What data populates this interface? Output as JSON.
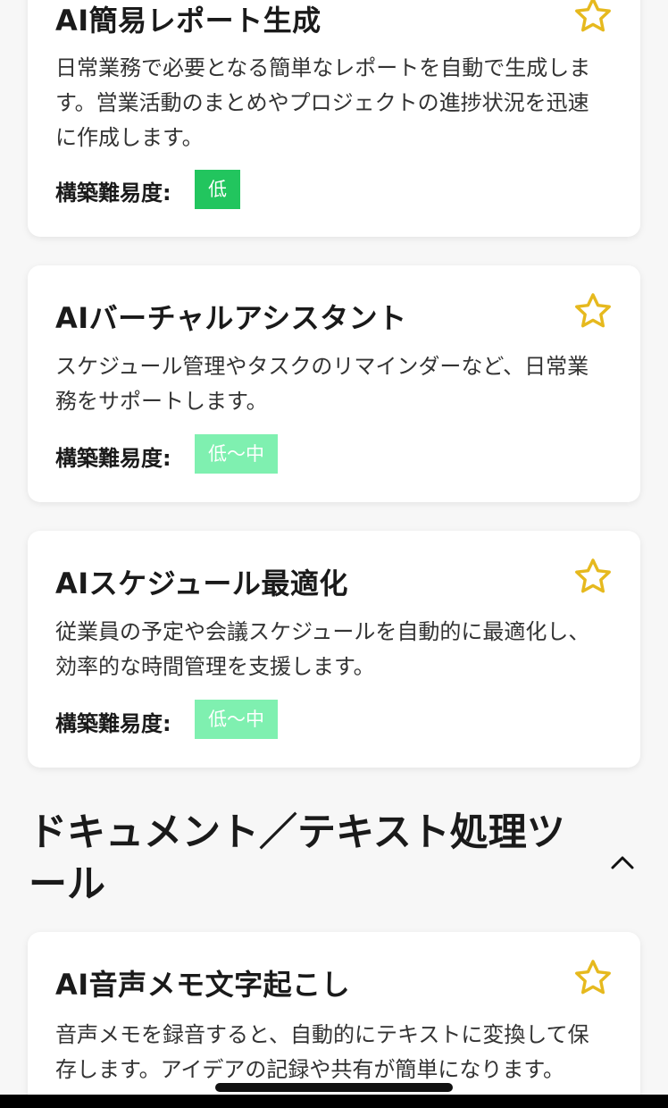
{
  "cards": [
    {
      "title": "AI簡易レポート生成",
      "description": "日常業務で必要となる簡単なレポートを自動で生成します。営業活動のまとめやプロジェクトの進捗状況を迅速に作成します。",
      "difficulty_label": "構築難易度:",
      "difficulty": "低"
    },
    {
      "title": "AIバーチャルアシスタント",
      "description": "スケジュール管理やタスクのリマインダーなど、日常業務をサポートします。",
      "difficulty_label": "構築難易度:",
      "difficulty": "低〜中"
    },
    {
      "title": "AIスケジュール最適化",
      "description": "従業員の予定や会議スケジュールを自動的に最適化し、効率的な時間管理を支援します。",
      "difficulty_label": "構築難易度:",
      "difficulty": "低〜中"
    },
    {
      "title": "AI音声メモ文字起こし",
      "description": "音声メモを録音すると、自動的にテキストに変換して保存します。アイデアの記録や共有が簡単になります。"
    }
  ],
  "section": {
    "title": "ドキュメント／テキスト処理ツール"
  },
  "colors": {
    "star": "#e6b91e",
    "badge_low": "#22c55e",
    "badge_low_mid": "#7ff0b0"
  },
  "icons": {
    "favorite": "star-outline-icon",
    "collapse": "chevron-up-icon"
  }
}
